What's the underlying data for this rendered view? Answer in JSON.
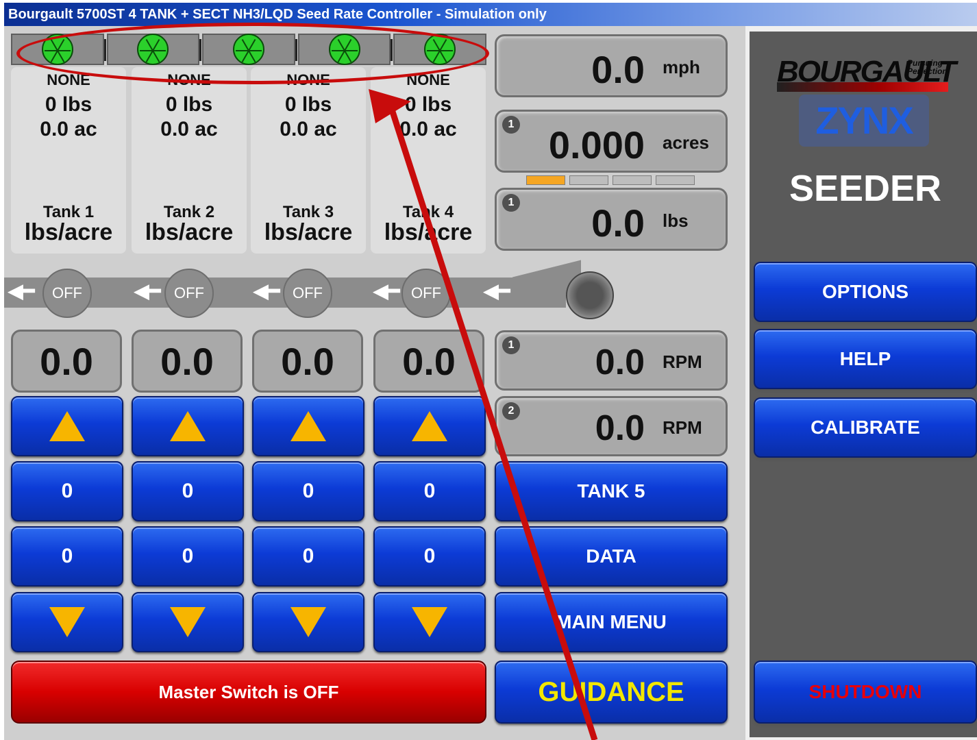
{
  "window": {
    "title": "Bourgault 5700ST 4 TANK + SECT NH3/LQD Seed Rate Controller - Simulation only"
  },
  "tanks": [
    {
      "product": "NONE",
      "weight": "0 lbs",
      "area": "0.0 ac",
      "name": "Tank 1",
      "unit": "lbs/acre",
      "state": "OFF",
      "rate": "0.0",
      "target": "0",
      "actual": "0"
    },
    {
      "product": "NONE",
      "weight": "0 lbs",
      "area": "0.0 ac",
      "name": "Tank 2",
      "unit": "lbs/acre",
      "state": "OFF",
      "rate": "0.0",
      "target": "0",
      "actual": "0"
    },
    {
      "product": "NONE",
      "weight": "0 lbs",
      "area": "0.0 ac",
      "name": "Tank 3",
      "unit": "lbs/acre",
      "state": "OFF",
      "rate": "0.0",
      "target": "0",
      "actual": "0"
    },
    {
      "product": "NONE",
      "weight": "0 lbs",
      "area": "0.0 ac",
      "name": "Tank 4",
      "unit": "lbs/acre",
      "state": "OFF",
      "rate": "0.0",
      "target": "0",
      "actual": "0"
    }
  ],
  "sections": {
    "count": 5,
    "color": "#2bd02b"
  },
  "readouts": {
    "speed": {
      "value": "0.0",
      "unit": "mph"
    },
    "area": {
      "index": "1",
      "value": "0.000",
      "unit": "acres"
    },
    "weight": {
      "index": "1",
      "value": "0.0",
      "unit": "lbs"
    },
    "fan1": {
      "index": "1",
      "value": "0.0",
      "unit": "RPM"
    },
    "fan2": {
      "index": "2",
      "value": "0.0",
      "unit": "RPM"
    }
  },
  "page_indicator": {
    "segments": 4,
    "active": 1,
    "active_color": "#f5a623"
  },
  "buttons": {
    "tank5": "TANK 5",
    "data": "DATA",
    "main_menu": "MAIN MENU",
    "guidance": "GUIDANCE",
    "master_switch": "Master Switch is OFF",
    "options": "OPTIONS",
    "help": "HELP",
    "calibrate": "CALIBRATE",
    "shutdown": "SHUTDOWN"
  },
  "branding": {
    "logo": "BOURGAULT",
    "tagline": "Pursuing Perfection",
    "product": "ZYNX",
    "mode": "SEEDER"
  },
  "colors": {
    "button_blue": "#0c3bd6",
    "master_red": "#d80000",
    "arrow_yellow": "#f7b500",
    "guidance_yellow": "#f2e600",
    "shutdown_red": "#e8000a",
    "annotation_red": "#c80c0c"
  }
}
